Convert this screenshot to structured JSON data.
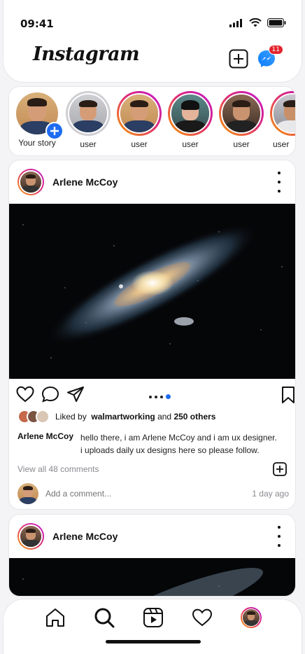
{
  "status_bar": {
    "time": "09:41"
  },
  "header": {
    "logo_text": "Instagram",
    "messenger_badge": "11",
    "icons": [
      "add-post-icon",
      "messenger-icon"
    ]
  },
  "stories": [
    {
      "label": "Your story"
    },
    {
      "label": "user"
    },
    {
      "label": "user"
    },
    {
      "label": "user"
    },
    {
      "label": "user"
    },
    {
      "label": "user"
    }
  ],
  "posts": [
    {
      "username": "Arlene McCoy",
      "liked_by_prefix": "Liked by",
      "liked_by_user": "walmartworking",
      "liked_by_and": "and",
      "liked_by_others": "250 others",
      "caption_user": "Arlene McCoy",
      "caption_line1": "hello there, i am Arlene McCoy and i am ux designer.",
      "caption_line2": "i uploads daily ux designs here so please follow.",
      "view_all": "View all 48 comments",
      "comment_placeholder": "Add a comment...",
      "time_ago": "1 day ago"
    },
    {
      "username": "Arlene McCoy"
    }
  ],
  "bottom_nav": [
    "home-icon",
    "search-icon",
    "reels-icon",
    "heart-icon",
    "profile-avatar"
  ],
  "colors": {
    "accent": "#1e6cf2",
    "badge": "#e2262f",
    "ring_start": "#f6a100",
    "ring_end": "#c013d0"
  }
}
